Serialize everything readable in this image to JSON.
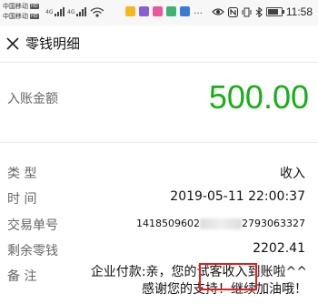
{
  "status_bar": {
    "carrier_1": "中国移动",
    "carrier_2": "中国移动",
    "hd_tag": "HD",
    "signal_text": "4G ıll  ıll",
    "time": "11:58",
    "icons": [
      "wifi-icon",
      "app-icon-yellow",
      "app-icon-purple",
      "app-icon-pink",
      "app-icon-green",
      "app-icon-blue",
      "ellipsis-icon"
    ],
    "right_icons": [
      "eye-icon",
      "nfc-icon",
      "vibrate-icon",
      "bluetooth-icon",
      "battery-icon"
    ]
  },
  "header": {
    "title": "零钱明细",
    "close_icon": "close-icon"
  },
  "amount": {
    "label": "入账金额",
    "value": "500.00",
    "color": "#1aad19"
  },
  "details": {
    "type_label": "类    型",
    "type_value": "收入",
    "time_label": "时    间",
    "time_value": "2019-05-11 22:00:37",
    "order_label": "交易单号",
    "order_prefix": "1418509602",
    "order_suffix": "2793063327",
    "balance_label": "剩余零钱",
    "balance_value": "2202.41",
    "remark_label": "备    注",
    "remark_value_line1": "企业付款:亲，您的试客收入到账啦^^",
    "remark_value_line2": "感谢您的支持！继续加油哦！"
  },
  "highlight_color": "#e02020"
}
